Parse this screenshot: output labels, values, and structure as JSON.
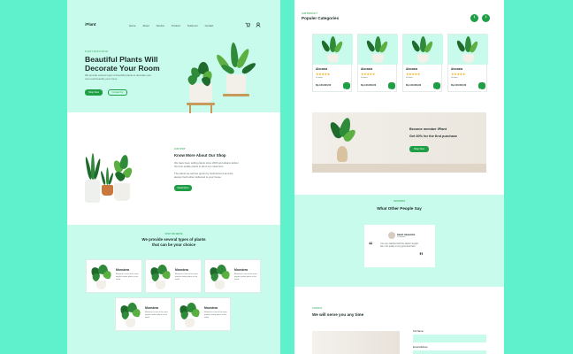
{
  "brand": {
    "logo_prefix": "i",
    "logo_text": "Plant"
  },
  "nav": {
    "items": [
      "Home",
      "About",
      "Service",
      "Product",
      "Testimoni",
      "Contact"
    ]
  },
  "hero": {
    "kicker": "PLANT EXCLUSIVE",
    "title_line1": "Beautiful Plants Will",
    "title_line2": "Decorate Your Room",
    "desc": "We provide various types of beautiful plants to decorate your room and beautify your home",
    "primary_btn": "Shop Now",
    "secondary_btn": "Contact Us"
  },
  "about": {
    "kicker": "OUR SHOP",
    "title": "Know More About Our Shop",
    "desc": "We have been selling plants since 2015 and always deliver the best quality plants to all of our customers",
    "desc2": "The plants we sell are grown by local farmers and are always fresh when delivered to your house",
    "btn": "Read More"
  },
  "services": {
    "kicker": "WHAT WE SERVE",
    "title_line1": "We provide several types of plants",
    "title_line2": "that can be your choice",
    "items": [
      {
        "name": "Monstera",
        "desc": "Monstera is one of the most popular indoor plants in the world"
      },
      {
        "name": "Monstera",
        "desc": "Monstera is one of the most popular indoor plants in the world"
      },
      {
        "name": "Monstera",
        "desc": "Monstera is one of the most popular indoor plants in the world"
      },
      {
        "name": "Monstera",
        "desc": "Monstera is one of the most popular indoor plants in the world"
      },
      {
        "name": "Monstera",
        "desc": "Monstera is one of the most popular indoor plants in the world"
      }
    ]
  },
  "popular": {
    "kicker": "OUR PRODUCT",
    "title": "Populer Categories",
    "prev_icon": "‹",
    "next_icon": "›",
    "products": [
      {
        "name": "Alocasia",
        "stars": "★★★★★",
        "sold": "50 Items",
        "price": "Rp 120.000,00",
        "cart_icon": "cart-icon"
      },
      {
        "name": "Alocasia",
        "stars": "★★★★★",
        "sold": "50 Items",
        "price": "Rp 120.000,00",
        "cart_icon": "cart-icon"
      },
      {
        "name": "Alocasia",
        "stars": "★★★★★",
        "sold": "50 Items",
        "price": "Rp 120.000,00",
        "cart_icon": "cart-icon"
      },
      {
        "name": "Alocasia",
        "stars": "★★★★★",
        "sold": "50 Items",
        "price": "Rp 120.000,00",
        "cart_icon": "cart-icon"
      }
    ]
  },
  "member": {
    "line1": "Become member iPlant",
    "line2": "Get 30% for the first purchase",
    "btn": "Shop Now"
  },
  "testimonial": {
    "kicker": "TESTIMONI",
    "title": "What Other People Say",
    "name": "Sarah Alexandra",
    "role": "Customer",
    "quote": "I am very satisfied with the plants I bought here, the quality is very good and fresh",
    "open_quote": "“",
    "close_quote": "”"
  },
  "contact": {
    "kicker": "CONTACT",
    "title": "We will serve you any time",
    "field1_label": "Full Name",
    "field2_label": "Email Address"
  }
}
